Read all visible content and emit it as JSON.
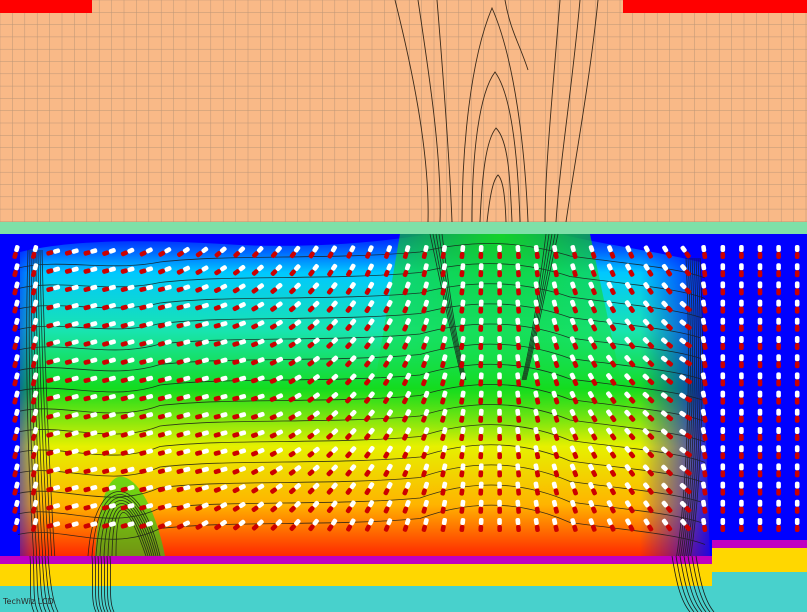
{
  "figure": {
    "kind": "lcd-director-field-simulation",
    "watermark": "TechWiz LCD"
  },
  "layers": [
    {
      "name": "upper-substrate",
      "color": "#f9b987"
    },
    {
      "name": "top-electrode-left",
      "color": "#ff0000"
    },
    {
      "name": "top-electrode-right",
      "color": "#ff0000"
    },
    {
      "name": "alignment-film-top",
      "color": "#7ee0a8"
    },
    {
      "name": "liquid-crystal-layer",
      "color": "#0000ff"
    },
    {
      "name": "pixel-electrode",
      "color": "#c000c0"
    },
    {
      "name": "passivation-layer",
      "color": "#ffd700"
    },
    {
      "name": "lower-substrate",
      "color": "#48d1cc"
    }
  ],
  "potential_colormap": [
    "#0014ff",
    "#00c8ff",
    "#18e4b0",
    "#14dc1e",
    "#e6f000",
    "#ffb400",
    "#ff2800"
  ],
  "director_colors": {
    "head": "#cc0000",
    "tail": "#ffffff"
  }
}
